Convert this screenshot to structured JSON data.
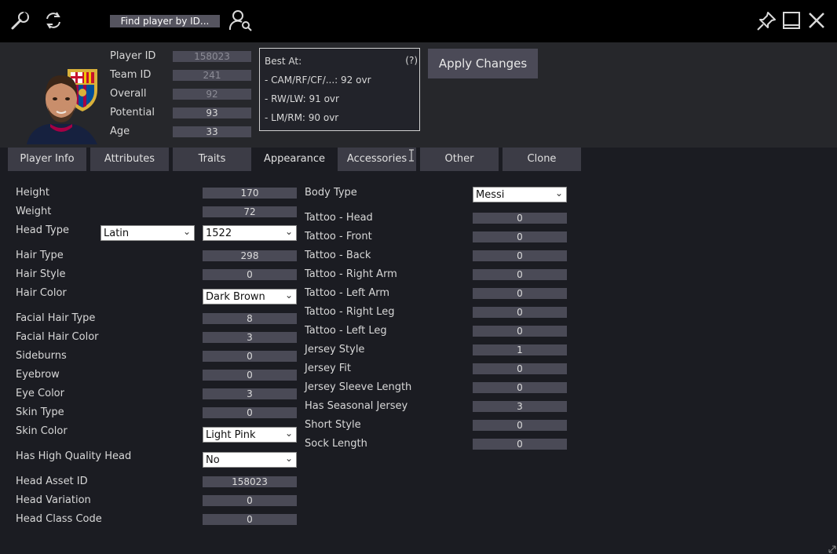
{
  "topbar": {
    "search_label": "Find player by ID...",
    "icons": [
      "wrench-icon",
      "refresh-icon",
      "user-search-icon",
      "pin-icon",
      "minimize-icon",
      "close-icon"
    ]
  },
  "header": {
    "fields": [
      {
        "label": "Player ID",
        "value": "158023"
      },
      {
        "label": "Team ID",
        "value": "241"
      },
      {
        "label": "Overall",
        "value": "92"
      },
      {
        "label": "Potential",
        "value": "93"
      },
      {
        "label": "Age",
        "value": "33"
      }
    ],
    "best_at": {
      "title": "Best At:",
      "help": "(?)",
      "lines": [
        "- CAM/RF/CF/...: 92 ovr",
        "- RW/LW: 91 ovr",
        "- LM/RM: 90 ovr"
      ]
    },
    "apply_label": "Apply Changes"
  },
  "tabs": [
    "Player Info",
    "Attributes",
    "Traits",
    "Appearance",
    "Accessories",
    "Other",
    "Clone"
  ],
  "active_tab": "Appearance",
  "left_form": [
    {
      "label": "Height",
      "type": "num",
      "value": "170"
    },
    {
      "label": "Weight",
      "type": "num",
      "value": "72"
    },
    {
      "label": "Head Type",
      "type": "dual",
      "select": "Latin",
      "value": "1522"
    },
    {
      "label": "Hair Type",
      "type": "num",
      "value": "298"
    },
    {
      "label": "Hair Style",
      "type": "num",
      "value": "0"
    },
    {
      "label": "Hair Color",
      "type": "select",
      "value": "Dark Brown"
    },
    {
      "label": "Facial Hair Type",
      "type": "num",
      "value": "8"
    },
    {
      "label": "Facial Hair Color",
      "type": "num",
      "value": "3"
    },
    {
      "label": "Sideburns",
      "type": "num",
      "value": "0"
    },
    {
      "label": "Eyebrow",
      "type": "num",
      "value": "0"
    },
    {
      "label": "Eye Color",
      "type": "num",
      "value": "3"
    },
    {
      "label": "Skin Type",
      "type": "num",
      "value": "0"
    },
    {
      "label": "Skin Color",
      "type": "select",
      "value": "Light Pink"
    },
    {
      "label": "Has High Quality Head",
      "type": "select",
      "value": "No"
    },
    {
      "label": "Head Asset ID",
      "type": "num",
      "value": "158023"
    },
    {
      "label": "Head Variation",
      "type": "num",
      "value": "0"
    },
    {
      "label": "Head Class Code",
      "type": "num",
      "value": "0"
    }
  ],
  "right_form": [
    {
      "label": "Body Type",
      "type": "select",
      "value": "Messi"
    },
    {
      "label": "Tattoo - Head",
      "type": "num",
      "value": "0"
    },
    {
      "label": "Tattoo - Front",
      "type": "num",
      "value": "0"
    },
    {
      "label": "Tattoo - Back",
      "type": "num",
      "value": "0"
    },
    {
      "label": "Tattoo - Right Arm",
      "type": "num",
      "value": "0"
    },
    {
      "label": "Tattoo - Left Arm",
      "type": "num",
      "value": "0"
    },
    {
      "label": "Tattoo - Right Leg",
      "type": "num",
      "value": "0"
    },
    {
      "label": "Tattoo - Left Leg",
      "type": "num",
      "value": "0"
    },
    {
      "label": "Jersey Style",
      "type": "num",
      "value": "1"
    },
    {
      "label": "Jersey Fit",
      "type": "num",
      "value": "0"
    },
    {
      "label": "Jersey Sleeve Length",
      "type": "num",
      "value": "0"
    },
    {
      "label": "Has Seasonal Jersey",
      "type": "num",
      "value": "3"
    },
    {
      "label": "Short Style",
      "type": "num",
      "value": "0"
    },
    {
      "label": "Sock Length",
      "type": "num",
      "value": "0"
    }
  ],
  "colors": {
    "background": "#1b1c22",
    "topbar": "#000000",
    "field": "#4a4a56",
    "tab": "#3c3c46",
    "crest_red": "#a50044",
    "crest_blue": "#004d98"
  }
}
